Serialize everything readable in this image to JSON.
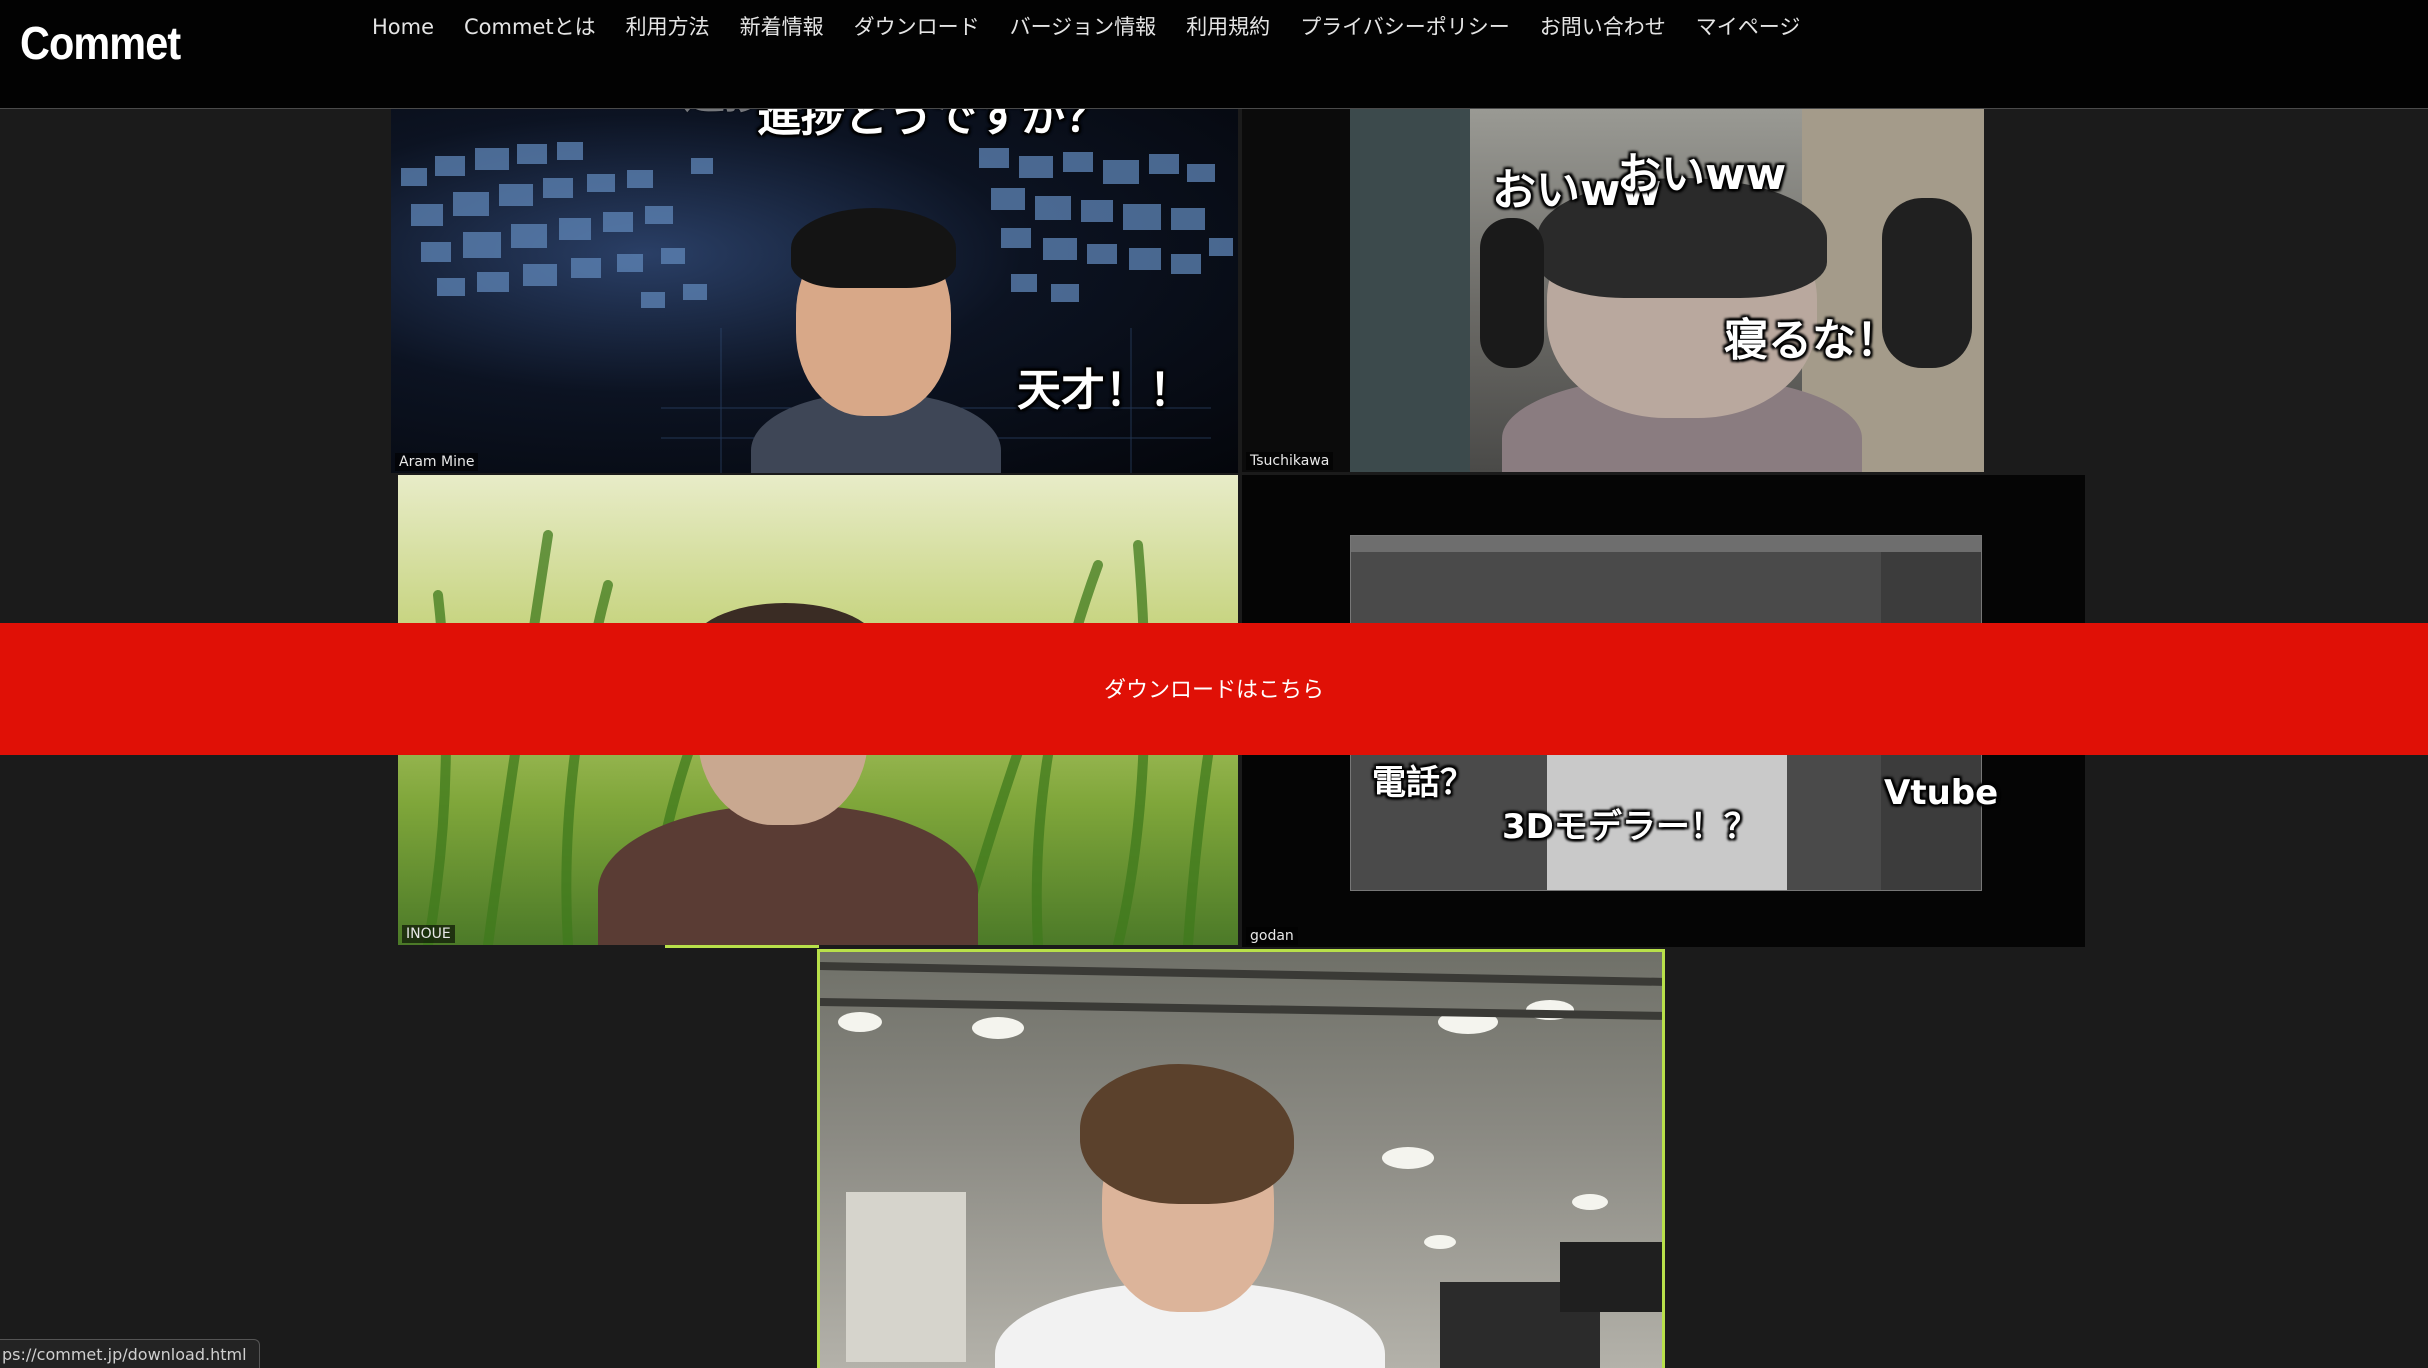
{
  "header": {
    "logo": "Commet",
    "nav": [
      {
        "label": "Home",
        "name": "nav-home"
      },
      {
        "label": "Commetとは",
        "name": "nav-about"
      },
      {
        "label": "利用方法",
        "name": "nav-usage"
      },
      {
        "label": "新着情報",
        "name": "nav-news"
      },
      {
        "label": "ダウンロード",
        "name": "nav-download"
      },
      {
        "label": "バージョン情報",
        "name": "nav-version"
      },
      {
        "label": "利用規約",
        "name": "nav-terms"
      },
      {
        "label": "プライバシーポリシー",
        "name": "nav-privacy"
      },
      {
        "label": "お問い合わせ",
        "name": "nav-contact"
      },
      {
        "label": "マイページ",
        "name": "nav-mypage"
      }
    ]
  },
  "tiles": {
    "aram": {
      "name": "Aram Mine",
      "comment_ghost": "進捗どうですか？",
      "comment_1": "進捗どうですか？",
      "comment_2": "天才！！"
    },
    "tsuchikawa": {
      "name": "Tsuchikawa",
      "comment_1": "おいww",
      "comment_2": "おいww",
      "comment_3": "寝るな！"
    },
    "inoue": {
      "name": "INOUE"
    },
    "godan": {
      "name": "godan",
      "comment_1": "電話？",
      "comment_2": "3Dモデラー！？",
      "comment_3": "Vtube"
    }
  },
  "banner": {
    "label": "ダウンロードはこちら",
    "color": "#e01006"
  },
  "status_bar": {
    "url": "ps://commet.jp/download.html"
  }
}
